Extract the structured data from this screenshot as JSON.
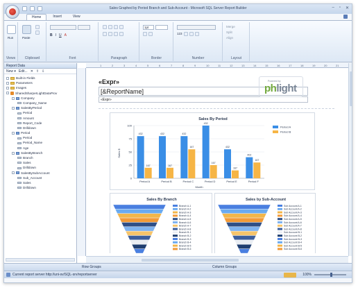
{
  "app": {
    "title": "Sales Graphed by Period Branch and Sub-Account - Microsoft SQL Server Report Builder",
    "window_buttons": [
      "–",
      "▫",
      "✕"
    ],
    "tabs": [
      "Home",
      "Insert",
      "View"
    ]
  },
  "ribbon": {
    "groups": [
      "Views",
      "Clipboard",
      "Font",
      "Paragraph",
      "Border",
      "Number",
      "Layout"
    ],
    "run_label": "Run",
    "paste_label": "Paste",
    "font_buttons": [
      "B",
      "I",
      "U",
      "A"
    ],
    "border_weight": "1pt",
    "number_sample": "123",
    "layout_items": [
      "Merge",
      "Split",
      "Align"
    ]
  },
  "report_data": {
    "header": "Report Data",
    "tools": [
      "New ▾",
      "Edit...",
      "✕",
      "⇧",
      "⇩"
    ],
    "tree": [
      {
        "label": "Built-in Fields",
        "level": 0,
        "icon": "folder"
      },
      {
        "label": "Parameters",
        "level": 0,
        "icon": "folder"
      },
      {
        "label": "Images",
        "level": 0,
        "icon": "folder"
      },
      {
        "label": "SharedSharperLightDataProv",
        "level": 0,
        "icon": "datasource"
      },
      {
        "label": "Company",
        "level": 1,
        "icon": "dataset"
      },
      {
        "label": "Company_Name",
        "level": 2,
        "icon": "field"
      },
      {
        "label": "SalesByPeriod",
        "level": 1,
        "icon": "dataset"
      },
      {
        "label": "Period",
        "level": 2,
        "icon": "field"
      },
      {
        "label": "Amount",
        "level": 2,
        "icon": "field"
      },
      {
        "label": "Report_Code",
        "level": 2,
        "icon": "field"
      },
      {
        "label": "Drilldown",
        "level": 2,
        "icon": "field"
      },
      {
        "label": "Period",
        "level": 1,
        "icon": "dataset"
      },
      {
        "label": "Period",
        "level": 2,
        "icon": "field"
      },
      {
        "label": "Period_Name",
        "level": 2,
        "icon": "field"
      },
      {
        "label": "Age",
        "level": 2,
        "icon": "field"
      },
      {
        "label": "SalesByBranch",
        "level": 1,
        "icon": "dataset"
      },
      {
        "label": "Branch",
        "level": 2,
        "icon": "field"
      },
      {
        "label": "Sales",
        "level": 2,
        "icon": "field"
      },
      {
        "label": "Drilldown",
        "level": 2,
        "icon": "field"
      },
      {
        "label": "SalesBySubAccount",
        "level": 1,
        "icon": "dataset"
      },
      {
        "label": "Sub_Account",
        "level": 2,
        "icon": "field"
      },
      {
        "label": "Sales",
        "level": 2,
        "icon": "field"
      },
      {
        "label": "Drilldown",
        "level": 2,
        "icon": "field"
      }
    ]
  },
  "ruler_marks": [
    "1",
    "2",
    "3",
    "4",
    "5",
    "6",
    "7",
    "8",
    "9",
    "10",
    "11",
    "12",
    "13",
    "14",
    "15",
    "16",
    "17",
    "18",
    "19",
    "20",
    "21"
  ],
  "report": {
    "expr_title": "«Expr»",
    "report_name": "[&ReportName]",
    "expr_small": "«Expr»",
    "logo_small": "Powered by",
    "logo_ph": "ph",
    "logo_rest": "light"
  },
  "colors": {
    "series_a": "#3a8ee6",
    "series_b": "#f6b545",
    "funnel": [
      "#4a7fe0",
      "#6aaaf0",
      "#f2b64a",
      "#f29a38",
      "#2f4f87",
      "#7fb3f0",
      "#f6c46a",
      "#3c5e9c",
      "#e9edf3",
      "#1f3e70"
    ]
  },
  "chart_data": [
    {
      "type": "bar",
      "title": "Sales By Period",
      "categories": [
        "Period A",
        "Period B",
        "Period C",
        "Period D",
        "Period E",
        "Period F"
      ],
      "series": [
        {
          "name": "Period A",
          "values": [
            432,
            432,
            432,
            432,
            432,
            402
          ]
        },
        {
          "name": "Period B",
          "values": [
            167,
            167,
            167,
            167,
            167,
            167
          ]
        }
      ],
      "xlabel": "Month",
      "ylabel": "Sales $",
      "ylim": [
        0,
        100
      ],
      "yticks": [
        0,
        25,
        50,
        75,
        100
      ],
      "heights": [
        80,
        20,
        80,
        20,
        80,
        55,
        100,
        25,
        55,
        15,
        40,
        30
      ],
      "legend": "top-right"
    },
    {
      "type": "funnel",
      "title": "Sales By Branch",
      "legend_entries": [
        "Branch A-1",
        "Branch A-2",
        "Branch A-3",
        "Branch A-4",
        "Branch A-5",
        "Branch A-6",
        "Branch A-7",
        "Branch A-8",
        "Branch B-1",
        "Branch B-2",
        "Branch B-3",
        "Branch B-4",
        "Branch B-5",
        "Branch B-6"
      ]
    },
    {
      "type": "funnel",
      "title": "Sales by Sub-Account",
      "legend_entries": [
        "Sub Account A-1",
        "Sub Account A-2",
        "Sub Account A-3",
        "Sub Account A-4",
        "Sub Account A-5",
        "Sub Account A-6",
        "Sub Account A-7",
        "Sub Account A-8",
        "Sub Account B-1",
        "Sub Account B-2",
        "Sub Account B-3",
        "Sub Account B-4",
        "Sub Account B-5",
        "Sub Account B-6"
      ]
    }
  ],
  "status": {
    "row_groups": "Row Groups",
    "column_groups": "Column Groups",
    "message": "Current report server http://uni-sv/SQL-srv/reportserver",
    "zoom": "100%"
  }
}
